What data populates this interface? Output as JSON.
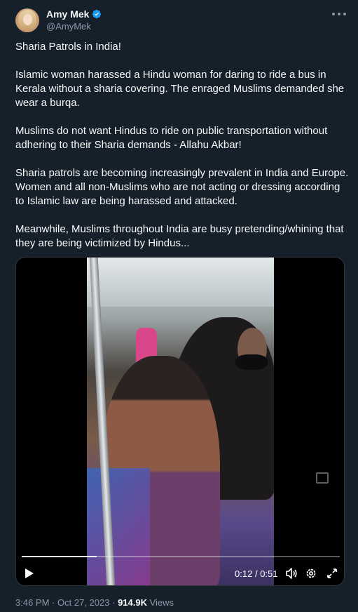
{
  "author": {
    "name": "Amy Mek",
    "handle": "@AmyMek",
    "verified_icon": "verified-badge-icon",
    "avatar_icon": "avatar"
  },
  "tweet": {
    "paragraphs": [
      "Sharia Patrols in India!",
      "Islamic woman harassed a Hindu woman for daring to ride a bus in Kerala without a sharia covering. The enraged Muslims demanded she wear a burqa.",
      "Muslims do not want Hindus to ride on public transportation without adhering to their Sharia demands - Allahu Akbar!",
      "Sharia patrols are becoming increasingly prevalent in India and Europe. Women and all non-Muslims who are not acting or dressing according to Islamic law are being harassed and attacked.",
      "Meanwhile, Muslims throughout India are busy pretending/whining that they are being victimized by Hindus..."
    ]
  },
  "video": {
    "current_time": "0:12",
    "separator": "/",
    "duration": "0:51",
    "progress": 0.235,
    "icons": [
      "play-icon",
      "volume-icon",
      "settings-gear-icon",
      "fullscreen-icon"
    ]
  },
  "meta": {
    "time": "3:46 PM",
    "dot": "·",
    "date": "Oct 27, 2023",
    "views_count": "914.9K",
    "views_label": "Views"
  },
  "colors": {
    "background": "#15202b",
    "text": "#f7f9f9",
    "secondary": "#8b98a5",
    "verified": "#1d9bf0"
  }
}
